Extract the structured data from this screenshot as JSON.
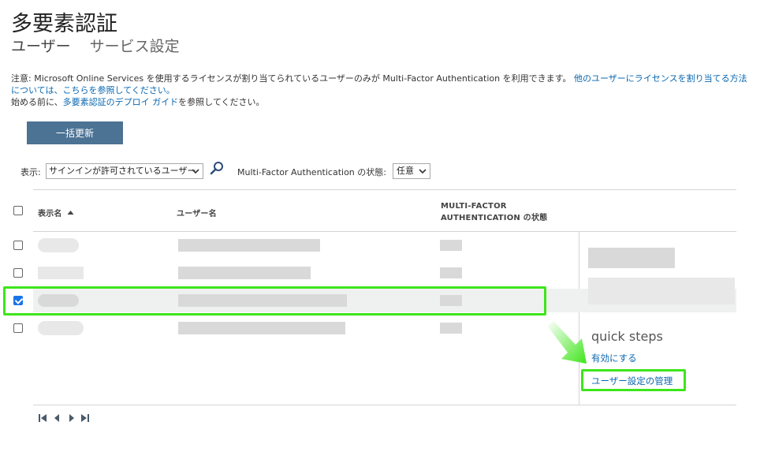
{
  "page": {
    "title": "多要素認証",
    "tabs": [
      {
        "label": "ユーザー"
      },
      {
        "label": "サービス設定"
      }
    ]
  },
  "notice": {
    "line1_text": "注意: Microsoft Online Services を使用するライセンスが割り当てられているユーザーのみが Multi-Factor Authentication を利用できます。",
    "line1_link": "他のユーザーにライセンスを割り当てる方法については、こちらを参照してください。",
    "line2_prefix": "始める前に、",
    "line2_link": "多要素認証のデプロイ ガイド",
    "line2_suffix": "を参照してください。"
  },
  "toolbar": {
    "bulk_update_label": "一括更新"
  },
  "filters": {
    "view_label": "表示:",
    "view_value": "サインインが許可されているユーザー",
    "mfa_label": "Multi-Factor Authentication の状態:",
    "mfa_value": "任意"
  },
  "table": {
    "columns": {
      "display_name": "表示名",
      "user_name": "ユーザー名",
      "mfa_status_line1": "MULTI-FACTOR",
      "mfa_status_line2": "AUTHENTICATION の状態"
    },
    "rows": [
      {
        "checked": false
      },
      {
        "checked": false
      },
      {
        "checked": true
      },
      {
        "checked": false
      }
    ]
  },
  "quick_steps": {
    "title": "quick steps",
    "enable": "有効にする",
    "manage_user_settings": "ユーザー設定の管理"
  },
  "colors": {
    "accent_button": "#4c7294",
    "link": "#0a67b0",
    "highlight": "#3ee51a",
    "checkbox_checked": "#1a73e8"
  },
  "icons": {
    "search": "search-icon",
    "sort_ascending": "sort-up-icon",
    "dropdown": "chevron-down-icon",
    "pager_first": "first-page-icon",
    "pager_prev": "prev-page-icon",
    "pager_next": "next-page-icon",
    "pager_last": "last-page-icon",
    "arrow": "arrow-pointer-icon"
  }
}
